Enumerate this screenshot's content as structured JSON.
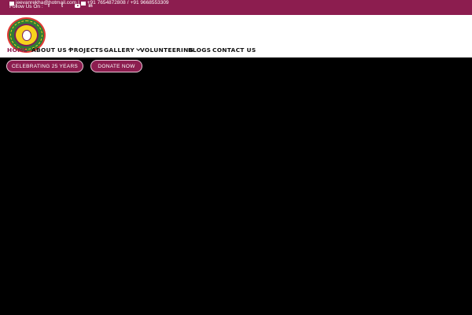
{
  "topbar": {
    "email": "jeevanrekha@hotmail.com",
    "phone1": "+91 7654872808",
    "divider": "/",
    "phone2": "+91 9668553309",
    "follow_label": "Follow Us On :",
    "social": [
      {
        "icon": "facebook-icon",
        "glyph": "f"
      },
      {
        "icon": "twitter-icon",
        "glyph": "t"
      },
      {
        "icon": "youtube-icon",
        "glyph": ""
      },
      {
        "icon": "linkedin-icon",
        "glyph": "in"
      }
    ]
  },
  "nav": {
    "home": "HOME",
    "about": "ABOUT US",
    "projects": "PROJECTS",
    "gallery": "GALLERY",
    "volunteering": "VOLUNTEERING",
    "blogs": "BLOGS",
    "contact": "CONTACT US"
  },
  "hero": {
    "celebrating": "CELEBRATING 25 YEARS",
    "donate": "DONATE NOW"
  },
  "colors": {
    "brand": "#8c1d4f",
    "hero_bg": "#000000"
  }
}
